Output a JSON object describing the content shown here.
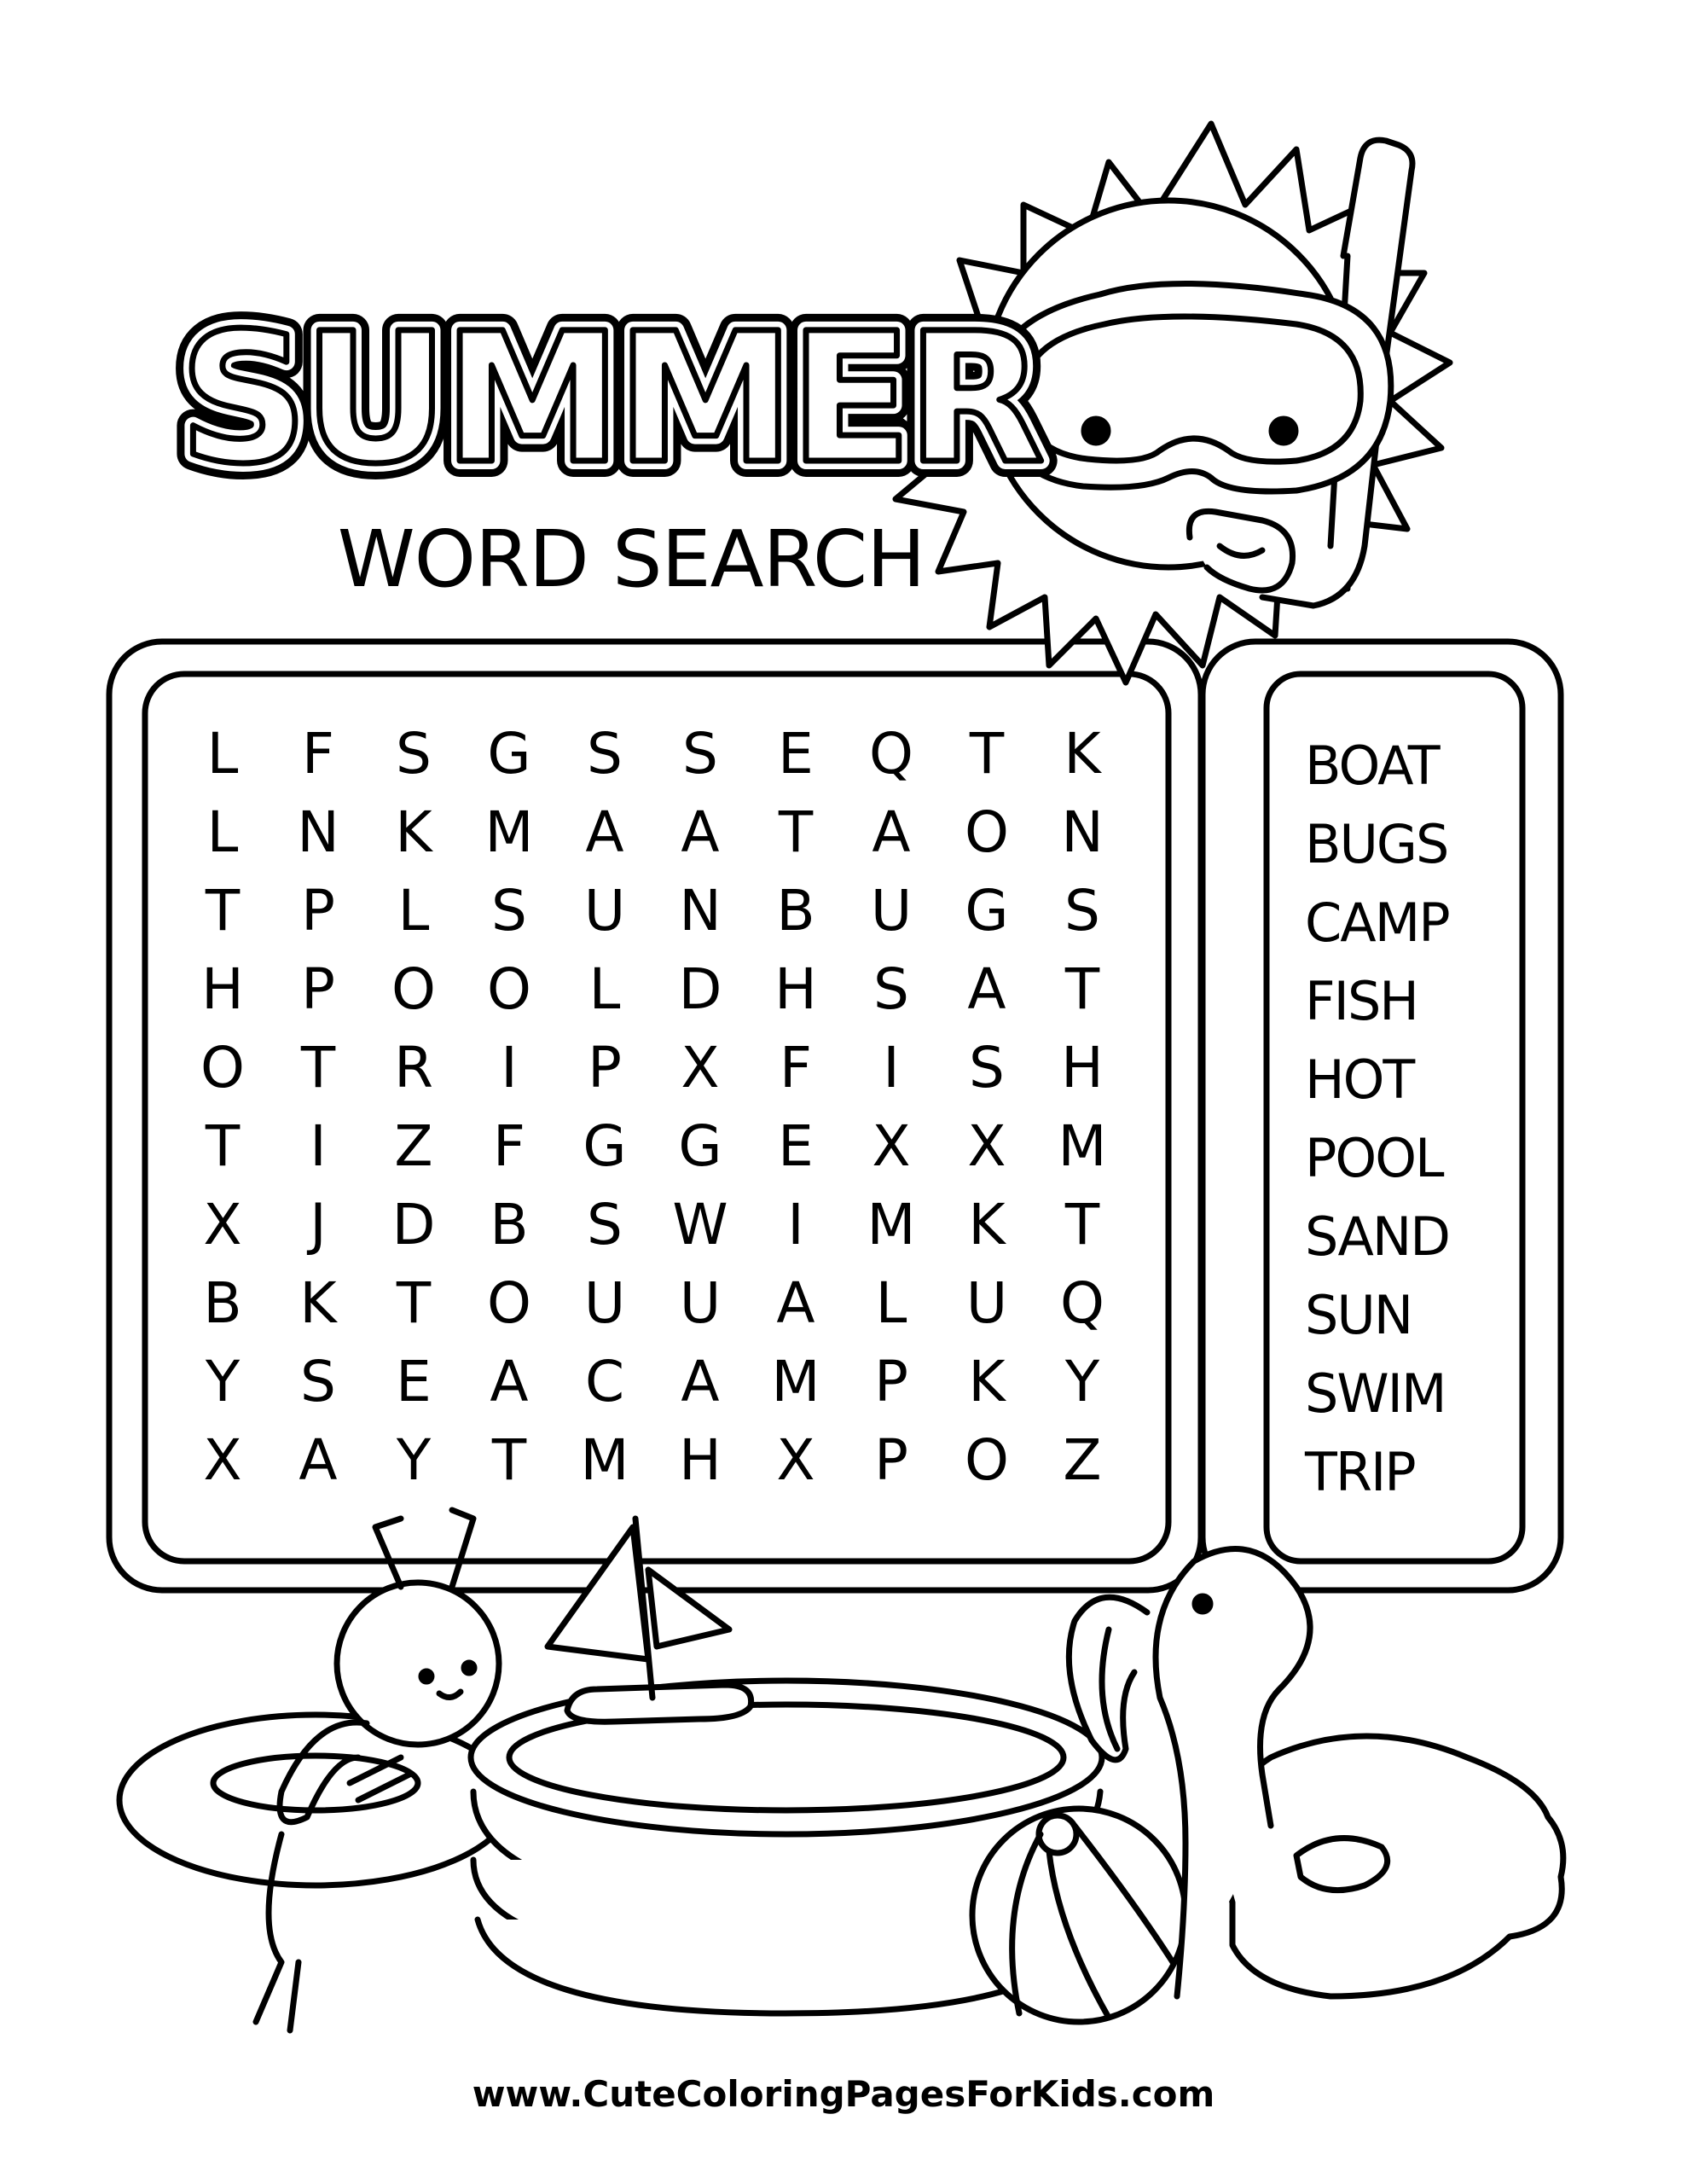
{
  "title": "SUMMER",
  "subtitle": "WORD SEARCH",
  "grid": [
    [
      "L",
      "F",
      "S",
      "G",
      "S",
      "S",
      "E",
      "Q",
      "T",
      "K"
    ],
    [
      "L",
      "N",
      "K",
      "M",
      "A",
      "A",
      "T",
      "A",
      "O",
      "N"
    ],
    [
      "T",
      "P",
      "L",
      "S",
      "U",
      "N",
      "B",
      "U",
      "G",
      "S"
    ],
    [
      "H",
      "P",
      "O",
      "O",
      "L",
      "D",
      "H",
      "S",
      "A",
      "T"
    ],
    [
      "O",
      "T",
      "R",
      "I",
      "P",
      "X",
      "F",
      "I",
      "S",
      "H"
    ],
    [
      "T",
      "I",
      "Z",
      "F",
      "G",
      "G",
      "E",
      "X",
      "X",
      "M"
    ],
    [
      "X",
      "J",
      "D",
      "B",
      "S",
      "W",
      "I",
      "M",
      "K",
      "T"
    ],
    [
      "B",
      "K",
      "T",
      "O",
      "U",
      "U",
      "A",
      "L",
      "U",
      "Q"
    ],
    [
      "Y",
      "S",
      "E",
      "A",
      "C",
      "A",
      "M",
      "P",
      "K",
      "Y"
    ],
    [
      "X",
      "A",
      "Y",
      "T",
      "M",
      "H",
      "X",
      "P",
      "O",
      "Z"
    ]
  ],
  "word_list": [
    "BOAT",
    "BUGS",
    "CAMP",
    "FISH",
    "HOT",
    "POOL",
    "SAND",
    "SUN",
    "SWIM",
    "TRIP"
  ],
  "footer": "www.CuteColoringPagesForKids.com",
  "illustrations": [
    "sun-with-snorkel-mask-icon",
    "ant-in-swim-ring-icon",
    "inflatable-pool-icon",
    "toy-sailboat-icon",
    "beach-ball-icon",
    "flamingo-float-icon"
  ]
}
